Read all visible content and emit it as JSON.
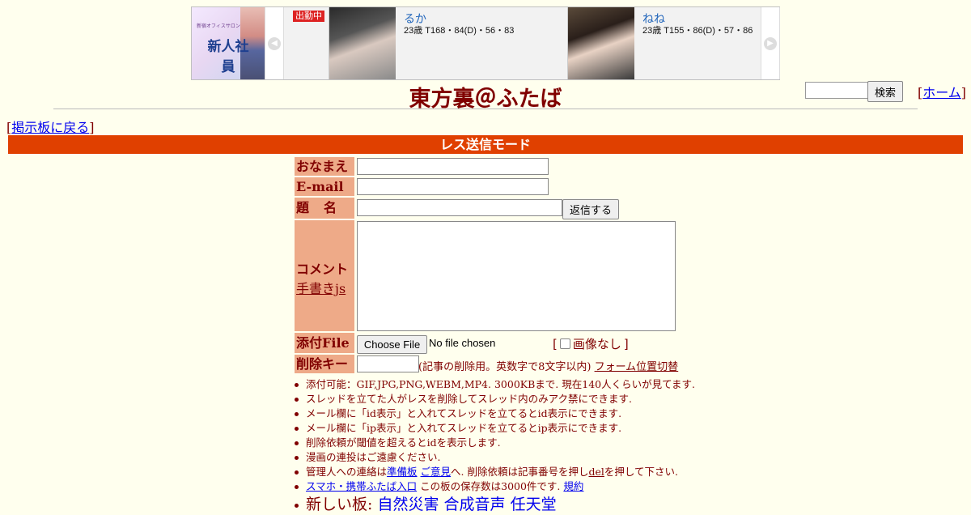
{
  "banner": {
    "thumb_logo_text": "新人社員",
    "thumb_logo_sub": "新宿オフィスサロン",
    "status_badge": "出勤中",
    "profiles": [
      {
        "name": "るか",
        "stats": "23歳 T168・84(D)・56・83"
      },
      {
        "name": "ねね",
        "stats": "23歳 T155・86(D)・57・86"
      }
    ]
  },
  "header": {
    "title": "東方裏＠ふたば",
    "search_button": "検索",
    "home_link": "ホーム",
    "back_link": "掲示板に戻る"
  },
  "mode_bar": "レス送信モード",
  "form": {
    "name_label": "おなまえ",
    "email_label": "E-mail",
    "subject_label": "題　名",
    "submit_button": "返信する",
    "comment_label": "コメント",
    "handwriting_link": "手書きjs",
    "file_label": "添付File",
    "file_button": "Choose File",
    "file_status": "No file chosen",
    "no_image_label": "画像なし",
    "delkey_label": "削除キー",
    "delkey_note": "(記事の削除用。英数字で8文字以内)",
    "form_toggle_link": "フォーム位置切替"
  },
  "notes": {
    "n1": "添付可能：GIF,JPG,PNG,WEBM,MP4. 3000KBまで. 現在140人くらいが見てます.",
    "n2": "スレッドを立てた人がレスを削除してスレッド内のみアク禁にできます.",
    "n3": "メール欄に「id表示」と入れてスレッドを立てるとid表示にできます.",
    "n4": "メール欄に「ip表示」と入れてスレッドを立てるとip表示にできます.",
    "n5": "削除依頼が閾値を超えるとidを表示します.",
    "n6": "漫画の連投はご遠慮ください.",
    "n7_pre": "管理人への連絡は",
    "n7_link1": "準備板",
    "n7_link2": "ご意見",
    "n7_mid": "へ. 削除依頼は記事番号を押し",
    "n7_link3": "del",
    "n7_post": "を押して下さい.",
    "n8_link": "スマホ・携帯ふたば入口",
    "n8_text": "この板の保存数は3000件です.",
    "n8_link2": "規約",
    "n9_prefix": "新しい板:",
    "new_boards": [
      "自然災害",
      "合成音声",
      "任天堂"
    ]
  }
}
